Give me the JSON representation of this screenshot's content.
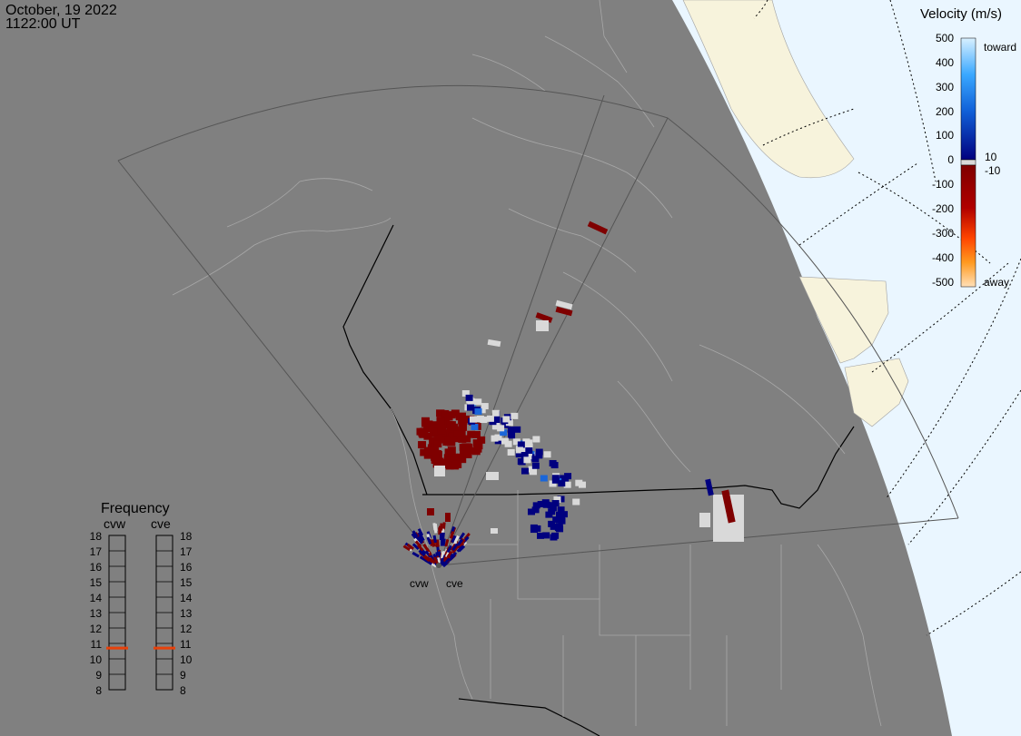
{
  "header": {
    "date": "October, 19 2022",
    "time": "1122:00 UT"
  },
  "velocity_legend": {
    "title": "Velocity (m/s)",
    "labels": [
      "500",
      "400",
      "300",
      "200",
      "100",
      "0",
      "-100",
      "-200",
      "-300",
      "-400",
      "-500"
    ],
    "toward_label": "toward",
    "away_label": "away",
    "threshold_pos": "10",
    "threshold_neg": "-10",
    "colors": {
      "toward_light": "#cfeeff",
      "toward_mid": "#1e90ff",
      "toward_dark": "#00007f",
      "away_dark": "#7f0000",
      "away_mid": "#ff6a00",
      "away_light": "#ffd9b0",
      "ground_scatter": "#d9d9d9"
    }
  },
  "frequency_panel": {
    "title": "Frequency",
    "radars": [
      {
        "name": "cvw",
        "frequency": 11
      },
      {
        "name": "cve",
        "frequency": 11
      }
    ],
    "scale": [
      "18",
      "17",
      "16",
      "15",
      "14",
      "13",
      "12",
      "11",
      "10",
      "9",
      "8"
    ]
  },
  "radar_sites": [
    "cvw",
    "cve"
  ],
  "map_colors": {
    "night": "#808080",
    "day_ocean": "#eaf6ff",
    "day_land": "#f7f3dc",
    "border": "#000000",
    "coastline": "#b0b0b0"
  }
}
